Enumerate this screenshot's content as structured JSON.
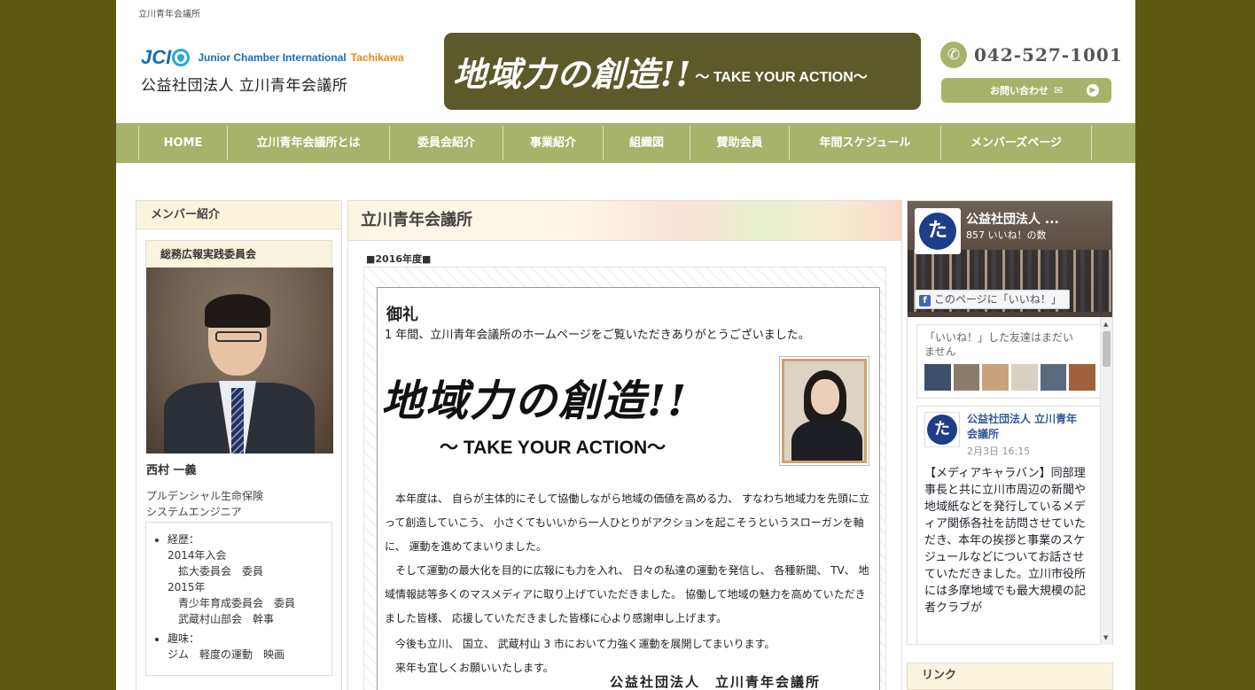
{
  "site_tag": "立川青年会議所",
  "logo": {
    "jci": "JCI",
    "name": "Junior Chamber International",
    "city": "Tachikawa",
    "org": "公益社団法人 立川青年会議所"
  },
  "banner": {
    "slogan": "地域力の創造!!",
    "sub": "～ TAKE YOUR ACTION～"
  },
  "contact": {
    "phone": "042-527-1001",
    "button": "お問い合わせ",
    "phone_icon": "phone-icon",
    "mail_icon": "mail-icon"
  },
  "nav": {
    "items": [
      "HOME",
      "立川青年会議所とは",
      "委員会紹介",
      "事業紹介",
      "組織図",
      "賛助会員",
      "年間スケジュール",
      "メンバーズページ"
    ]
  },
  "sidebar": {
    "heading": "メンバー紹介",
    "committee": "総務広報実践委員会",
    "member_name": "西村 一義",
    "company": "プルデンシャル生命保険",
    "position": "システムエンジニア",
    "history_label": "経歴：",
    "history": [
      "2014年入会",
      "拡大委員会　委員",
      "2015年",
      "青少年育成委員会　委員",
      "武蔵村山部会　幹事"
    ],
    "hobby_label": "趣味：",
    "hobby": "ジム　軽度の運動　映画"
  },
  "main": {
    "heading": "立川青年会議所",
    "year": "■2016年度■",
    "letter": {
      "orei": "御礼",
      "intro": "1 年間、立川青年会議所のホームページをご覧いただきありがとうございました。",
      "slogan": "地域力の創造!!",
      "tagline": "～ TAKE YOUR ACTION～",
      "p1": "　本年度は、 自らが主体的にそして協働しながら地域の価値を高める力、 すなわち地域力を先頭に立って創造していこう、 小さくてもいいから一人ひとりがアクションを起こそうというスローガンを軸に、 運動を進めてまいりました。",
      "p2": "　そして運動の最大化を目的に広報にも力を入れ、 日々の私達の運動を発信し、 各種新聞、 TV、 地域情報誌等多くのマスメディアに取り上げていただきました。 協働して地域の魅力を高めていただきました皆様、 応援していただきました皆様に心より感謝申し上げます。",
      "p3": "　今後も立川、 国立、 武蔵村山 3 市において力強く運動を展開してまいります。",
      "p4": "　来年も宜しくお願いいたします。",
      "sign": "公益社団法人　立川青年会議所"
    }
  },
  "facebook": {
    "logo_char": "た",
    "page_title": "公益社団法人 ...",
    "likes": "857 いいね！の数",
    "like_button": "このページに「いいね！」",
    "friends_text": "「いいね！」した友達はまだいません",
    "friend_colors": [
      "#3d4f6a",
      "#8b7d6b",
      "#c9a27e",
      "#d8d0c2",
      "#596a7e",
      "#a0603a"
    ],
    "post_page_name": "公益社団法人 立川青年会議所",
    "post_date": "2月3日 16:15",
    "post_body": "【メディアキャラバン】同部理事長と共に立川市周辺の新聞や地域紙などを発行しているメディア関係各社を訪問させていただき、本年の挨拶と事業のスケジュールなどについてお話させていただきました。立川市役所には多摩地域でも最大規模の記者クラブが"
  },
  "links": {
    "heading": "リンク"
  },
  "colors": {
    "background": "#5c5a12",
    "nav": "#a7b36b",
    "banner": "#5c5a2a",
    "fb_blue": "#365899"
  }
}
